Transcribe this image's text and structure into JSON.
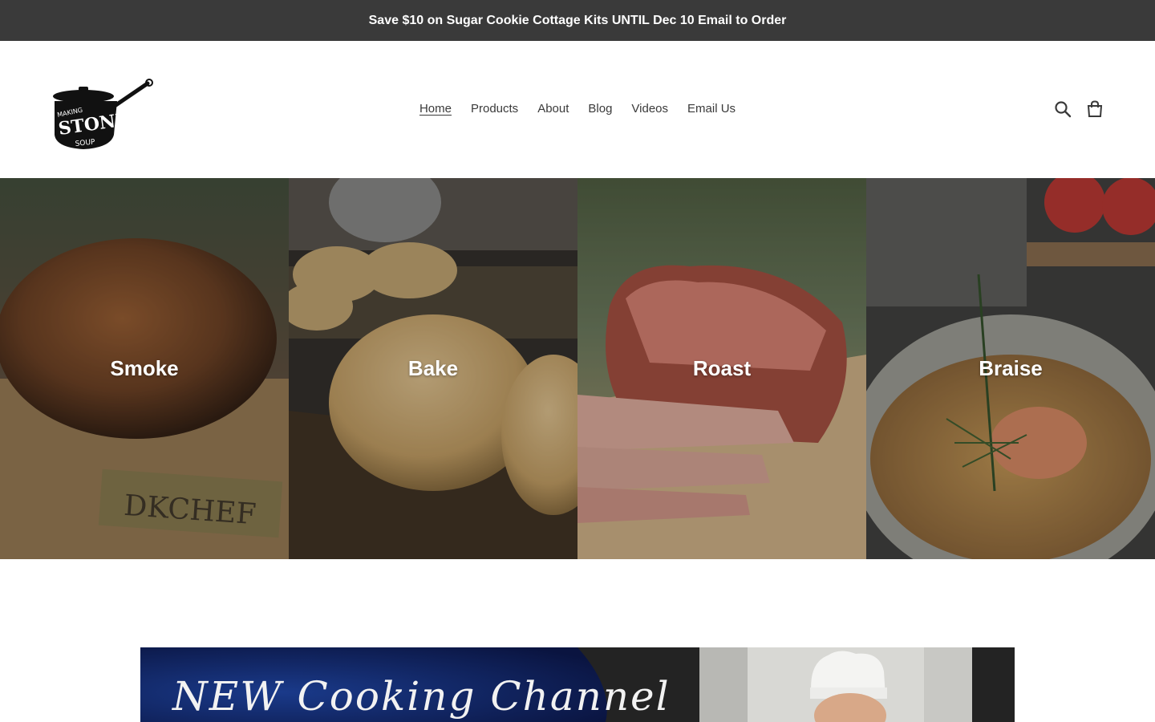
{
  "announcement": {
    "text": "Save $10 on Sugar Cookie Cottage Kits UNTIL Dec 10 Email to Order"
  },
  "header": {
    "logo": {
      "text_top": "MAKING",
      "text_main": "STONE",
      "text_bottom": "SOUP"
    },
    "nav": [
      {
        "label": "Home",
        "active": true
      },
      {
        "label": "Products"
      },
      {
        "label": "About"
      },
      {
        "label": "Blog"
      },
      {
        "label": "Videos"
      },
      {
        "label": "Email Us"
      }
    ],
    "icons": {
      "search": "search-icon",
      "cart": "cart-icon"
    }
  },
  "collections": [
    {
      "title": "Smoke",
      "image_text": "DKCHEF"
    },
    {
      "title": "Bake"
    },
    {
      "title": "Roast"
    },
    {
      "title": "Braise"
    }
  ],
  "banner": {
    "headline": "NEW Cooking Channel"
  },
  "colors": {
    "announcement_bg": "#3a3a3a",
    "text": "#3a3a3a",
    "banner_blue": "#0f1f5c"
  }
}
